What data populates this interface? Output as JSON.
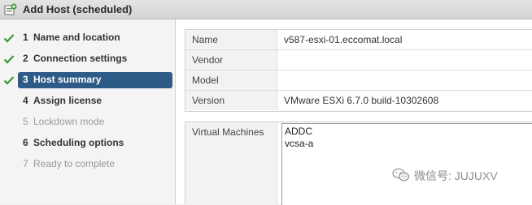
{
  "window": {
    "title": "Add Host (scheduled)",
    "icon": "add-host-icon"
  },
  "steps": [
    {
      "number": "1",
      "label": "Name and location",
      "state": "completed"
    },
    {
      "number": "2",
      "label": "Connection settings",
      "state": "completed"
    },
    {
      "number": "3",
      "label": "Host summary",
      "state": "active"
    },
    {
      "number": "4",
      "label": "Assign license",
      "state": "enabled"
    },
    {
      "number": "5",
      "label": "Lockdown mode",
      "state": "disabled"
    },
    {
      "number": "6",
      "label": "Scheduling options",
      "state": "enabled"
    },
    {
      "number": "7",
      "label": "Ready to complete",
      "state": "disabled"
    }
  ],
  "summary": {
    "rows": [
      {
        "key": "Name",
        "value": "v587-esxi-01.eccomat.local"
      },
      {
        "key": "Vendor",
        "value": ""
      },
      {
        "key": "Model",
        "value": ""
      },
      {
        "key": "Version",
        "value": "VMware ESXi 6.7.0 build-10302608"
      }
    ],
    "vm_label": "Virtual Machines",
    "vms": [
      "ADDC",
      "vcsa-a"
    ]
  },
  "watermark": {
    "text": "微信号: JUJUXV",
    "icon": "wechat-icon"
  },
  "colors": {
    "active_step_bg": "#2e5a87",
    "check_green": "#3a9a3a"
  }
}
